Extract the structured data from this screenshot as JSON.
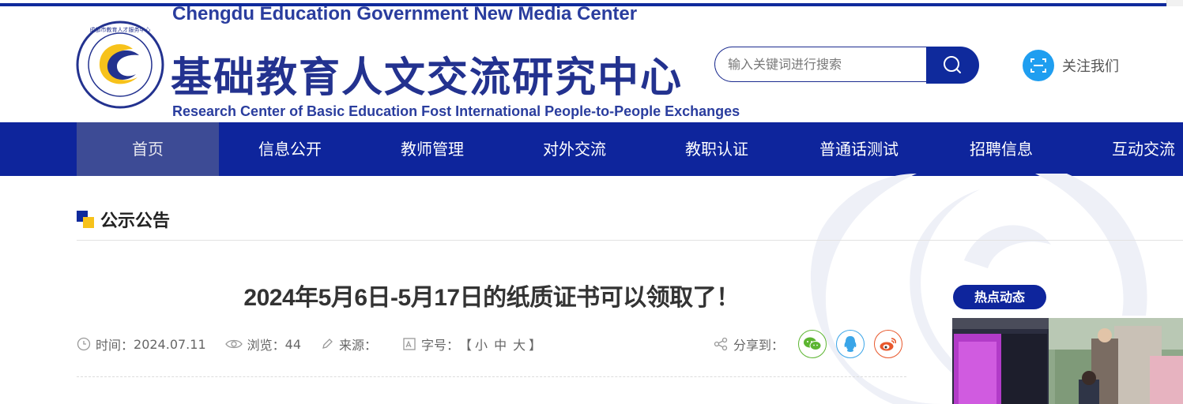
{
  "header": {
    "en_top": "Chengdu Education Government New Media Center",
    "title_cn": "基础教育人文交流研究中心",
    "en_bottom": "Research Center of Basic Education Fost International People-to-People Exchanges",
    "logo_icon": "education-center-logo"
  },
  "search": {
    "placeholder": "输入关键词进行搜索",
    "button_icon": "search-icon"
  },
  "follow": {
    "label": "关注我们",
    "icon": "scan-icon"
  },
  "nav": {
    "items": [
      {
        "label": "首页"
      },
      {
        "label": "信息公开"
      },
      {
        "label": "教师管理"
      },
      {
        "label": "对外交流"
      },
      {
        "label": "教职认证"
      },
      {
        "label": "普通话测试"
      },
      {
        "label": "招聘信息"
      },
      {
        "label": "互动交流"
      }
    ]
  },
  "section": {
    "title": "公示公告"
  },
  "article": {
    "title": "2024年5月6日-5月17日的纸质证书可以领取了！",
    "time_label": "时间：",
    "time_value": "2024.07.11",
    "views_label": "浏览：",
    "views_value": "44",
    "source_label": "来源：",
    "source_value": "",
    "fontsize_label": "字号：",
    "fontsize_open": "【",
    "fontsize_small": "小",
    "fontsize_medium": "中",
    "fontsize_large": "大",
    "fontsize_close": "】"
  },
  "share": {
    "label": "分享到：",
    "targets": [
      "wechat-icon",
      "qq-icon",
      "weibo-icon"
    ]
  },
  "sidebar": {
    "hot_title": "热点动态"
  },
  "colors": {
    "brand_blue": "#0e259c",
    "accent_yellow": "#f7c21b",
    "wechat_green": "#5cb531",
    "qq_blue": "#3aa5e8",
    "weibo_red": "#e8582c"
  }
}
